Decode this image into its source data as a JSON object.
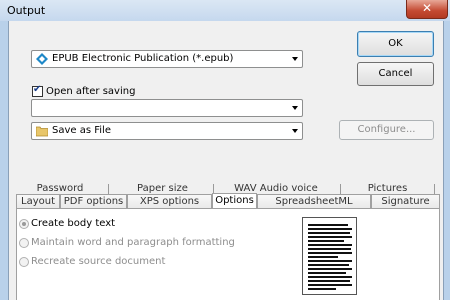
{
  "window": {
    "title": "Output",
    "close_glyph": "✕"
  },
  "format_select": {
    "value": "EPUB Electronic Publication (*.epub)",
    "icon": "epub-icon"
  },
  "open_after_saving": {
    "label": "Open after saving",
    "checked": true
  },
  "app_select": {
    "value": ""
  },
  "destination_select": {
    "value": "Save as File",
    "icon": "folder-icon"
  },
  "buttons": {
    "ok": "OK",
    "cancel": "Cancel",
    "configure": "Configure..."
  },
  "tabs": {
    "row1": [
      "Password",
      "Paper size",
      "WAV Audio voice",
      "Pictures"
    ],
    "row2": [
      "Layout",
      "PDF options",
      "XPS options",
      "Options",
      "SpreadsheetML options",
      "Signature"
    ],
    "active": "Options"
  },
  "options": {
    "create_body_text": "Create body text",
    "maintain_formatting": "Maintain word and paragraph formatting",
    "recreate_source": "Recreate source document",
    "selected": "create_body_text"
  }
}
